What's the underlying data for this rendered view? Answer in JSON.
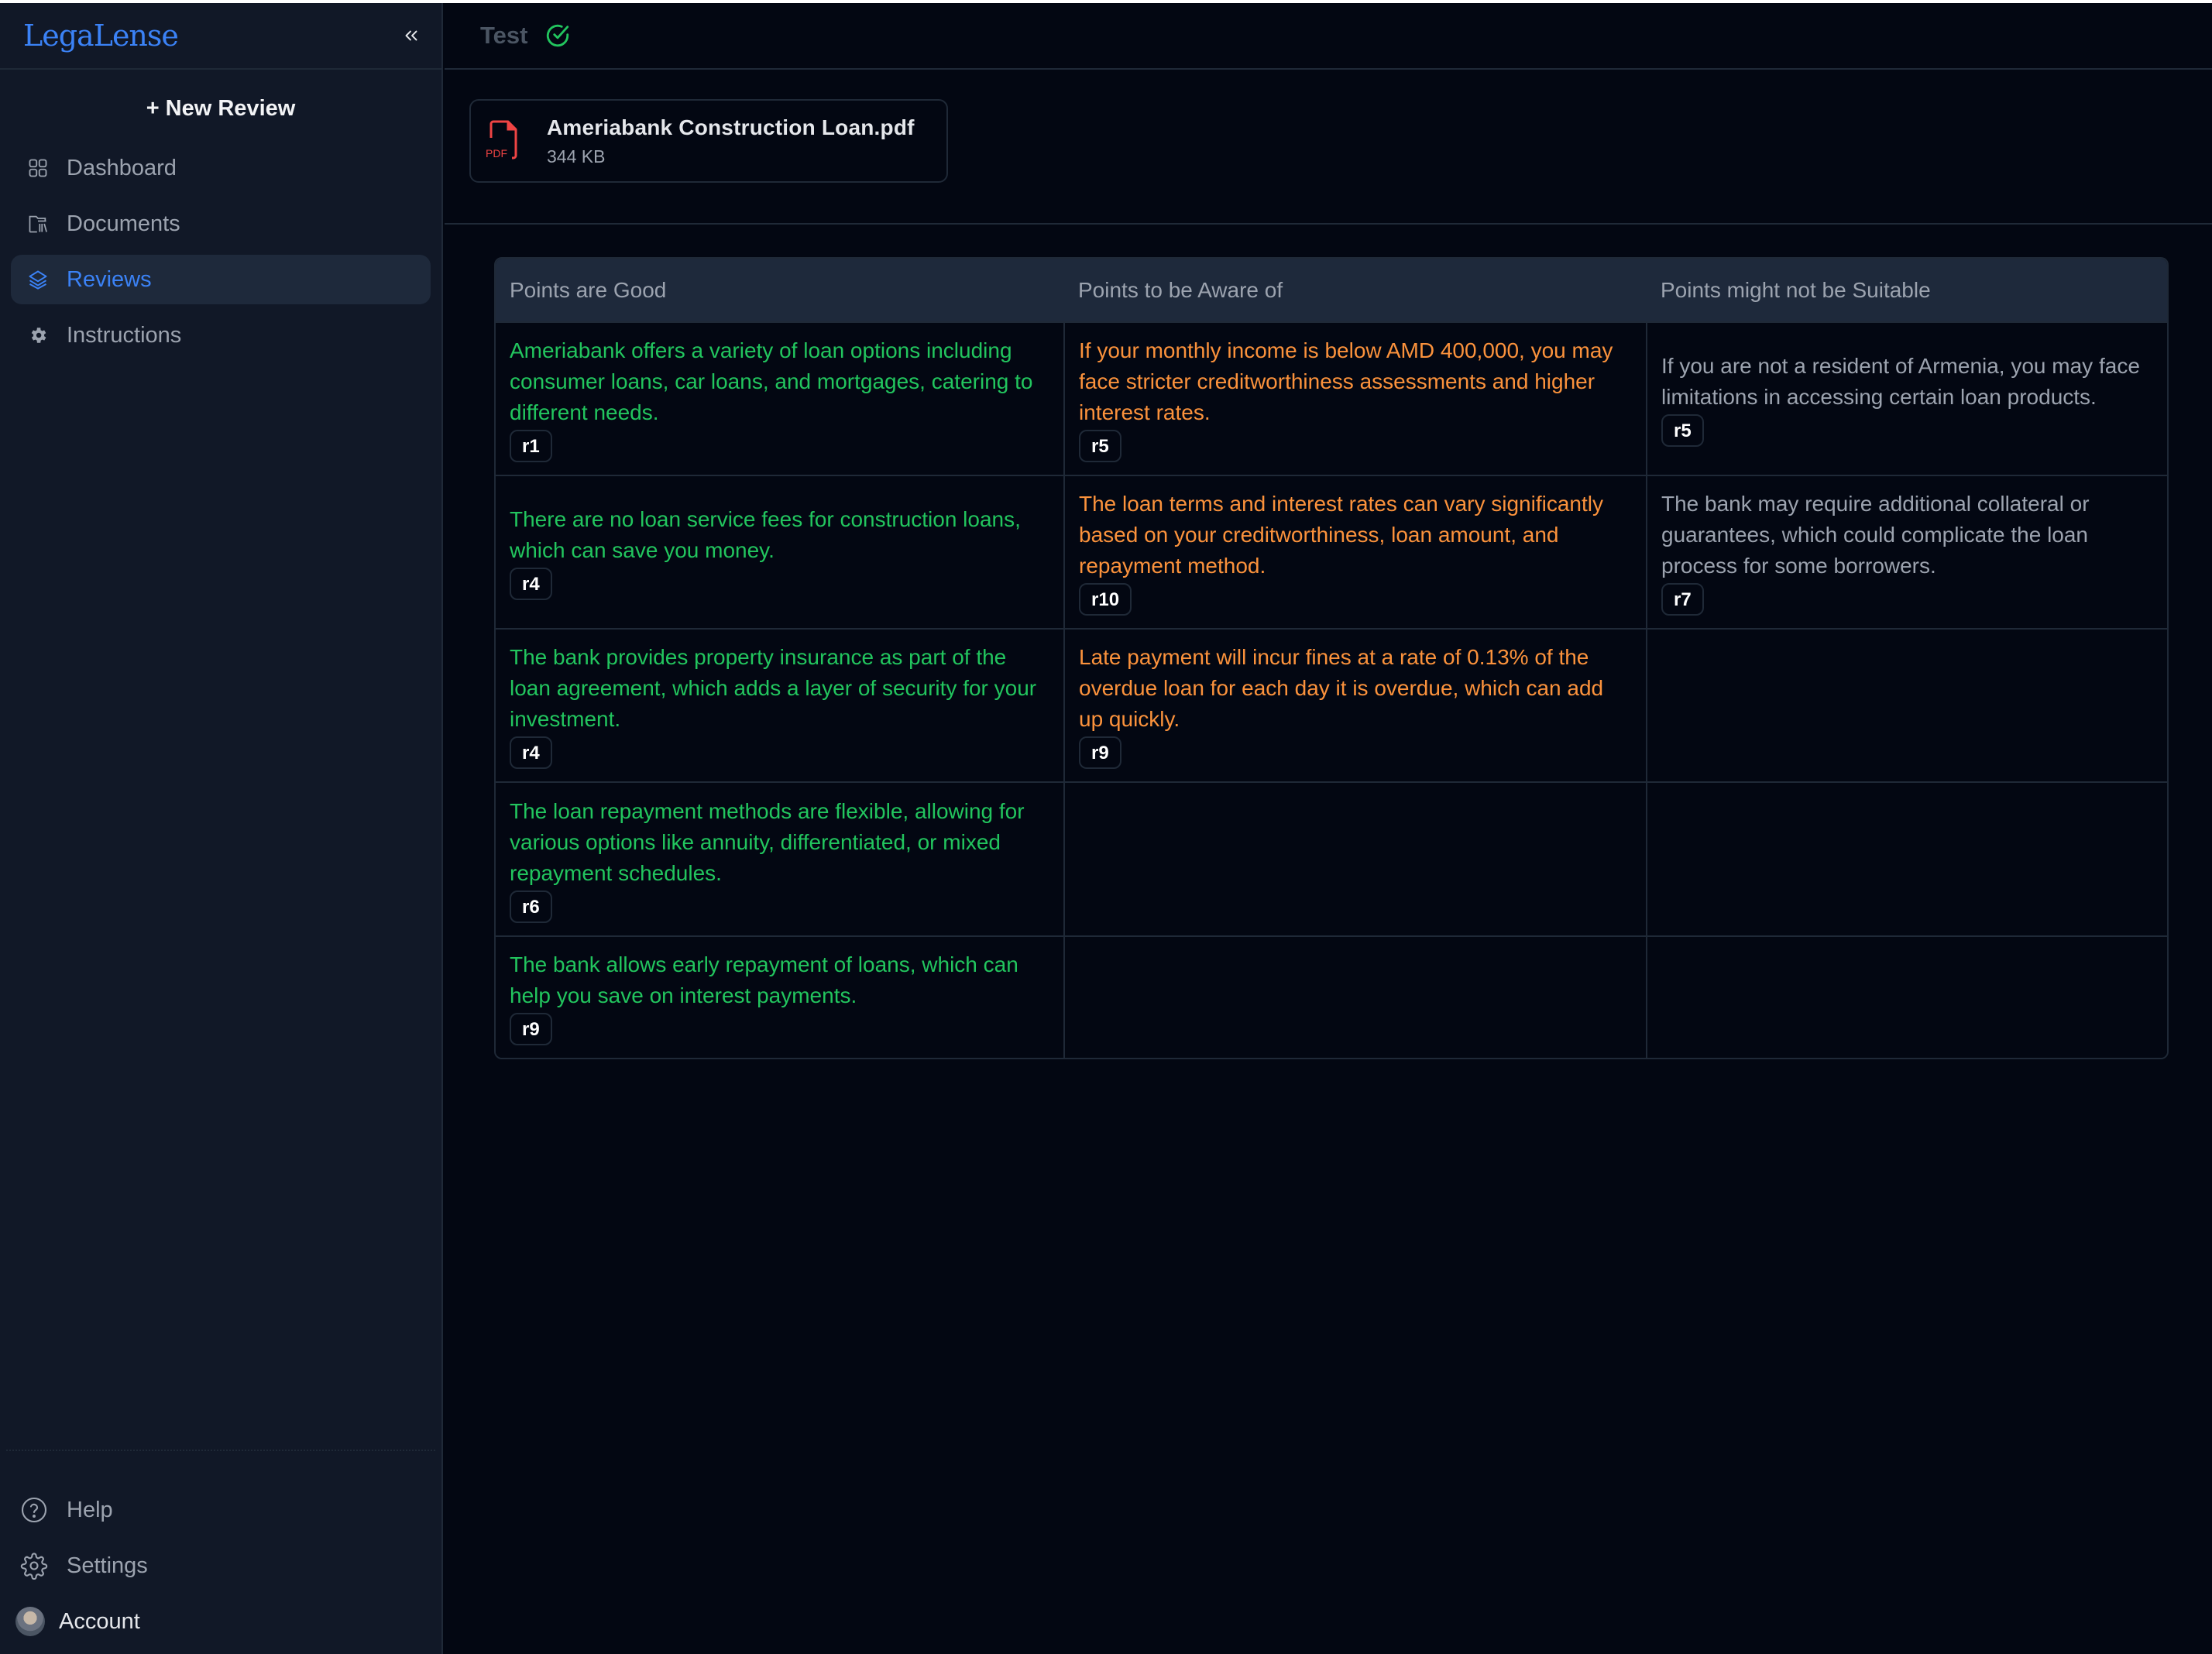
{
  "app": {
    "brand": "LegaLense"
  },
  "sidebar": {
    "new_review_label": "+ New Review",
    "items": [
      {
        "label": "Dashboard",
        "icon": "grid-icon",
        "active": false
      },
      {
        "label": "Documents",
        "icon": "archive-icon",
        "active": false
      },
      {
        "label": "Reviews",
        "icon": "layers-icon",
        "active": true
      },
      {
        "label": "Instructions",
        "icon": "cog-icon",
        "active": false
      }
    ],
    "bottom": {
      "help_label": "Help",
      "settings_label": "Settings",
      "account_label": "Account"
    }
  },
  "header": {
    "title": "Test",
    "status_icon": "check-circle-icon",
    "status_color": "#22c55e"
  },
  "file": {
    "name": "Ameriabank Construction Loan.pdf",
    "size": "344 KB",
    "type_label": "PDF"
  },
  "table": {
    "headers": [
      "Points are Good",
      "Points to be Aware of",
      "Points might not be Suitable"
    ],
    "colors": {
      "good": "#22c55e",
      "aware": "#fb923c",
      "unsuitable": "#9ca3af"
    },
    "rows": [
      {
        "good": {
          "text": "Ameriabank offers a variety of loan options including consumer loans, car loans, and mortgages, catering to different needs.",
          "ref": "r1"
        },
        "aware": {
          "text": "If your monthly income is below AMD 400,000, you may face stricter creditworthiness assessments and higher interest rates.",
          "ref": "r5"
        },
        "unsuitable": {
          "text": "If you are not a resident of Armenia, you may face limitations in accessing certain loan products.",
          "ref": "r5"
        }
      },
      {
        "good": {
          "text": "There are no loan service fees for construction loans, which can save you money.",
          "ref": "r4"
        },
        "aware": {
          "text": "The loan terms and interest rates can vary significantly based on your creditworthiness, loan amount, and repayment method.",
          "ref": "r10"
        },
        "unsuitable": {
          "text": "The bank may require additional collateral or guarantees, which could complicate the loan process for some borrowers.",
          "ref": "r7"
        }
      },
      {
        "good": {
          "text": "The bank provides property insurance as part of the loan agreement, which adds a layer of security for your investment.",
          "ref": "r4"
        },
        "aware": {
          "text": "Late payment will incur fines at a rate of 0.13% of the overdue loan for each day it is overdue, which can add up quickly.",
          "ref": "r9"
        },
        "unsuitable": null
      },
      {
        "good": {
          "text": "The loan repayment methods are flexible, allowing for various options like annuity, differentiated, or mixed repayment schedules.",
          "ref": "r6"
        },
        "aware": null,
        "unsuitable": null
      },
      {
        "good": {
          "text": "The bank allows early repayment of loans, which can help you save on interest payments.",
          "ref": "r9"
        },
        "aware": null,
        "unsuitable": null
      }
    ]
  }
}
